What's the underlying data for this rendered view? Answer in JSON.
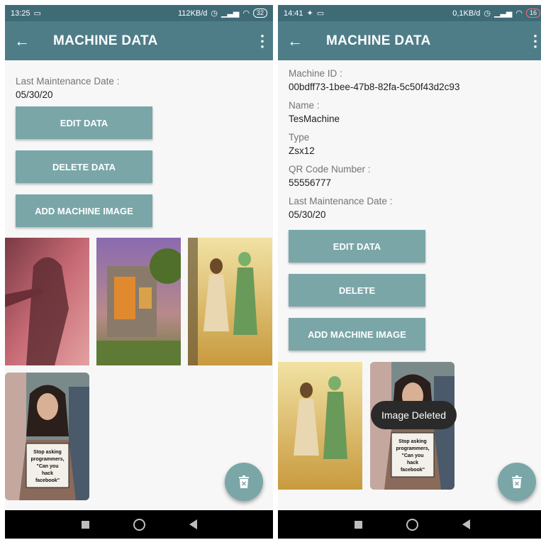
{
  "left": {
    "status": {
      "time": "13:25",
      "speed": "112KB/d",
      "battery": "32"
    },
    "appbar": {
      "title": "MACHINE DATA"
    },
    "fields": [
      {
        "label": "Last Maintenance Date :",
        "value": "05/30/20"
      }
    ],
    "buttons": {
      "edit": "EDIT DATA",
      "delete": "DELETE DATA",
      "add_image": "ADD MACHINE IMAGE"
    },
    "images": [
      "woman-silhouette-photo",
      "stone-house-photo",
      "anime-couple-photo",
      "protest-sign-photo"
    ],
    "sign_text": [
      "Stop asking",
      "programmers,",
      "\"Can you",
      "hack",
      "facebook\""
    ]
  },
  "right": {
    "status": {
      "time": "14:41",
      "speed": "0,1KB/d",
      "battery": "16"
    },
    "appbar": {
      "title": "MACHINE DATA"
    },
    "fields": [
      {
        "label": "Machine ID :",
        "value": "00bdff73-1bee-47b8-82fa-5c50f43d2c93"
      },
      {
        "label": "Name :",
        "value": "TesMachine"
      },
      {
        "label": "Type",
        "value": "Zsx12"
      },
      {
        "label": "QR Code Number :",
        "value": "55556777"
      },
      {
        "label": "Last Maintenance Date :",
        "value": "05/30/20"
      }
    ],
    "buttons": {
      "edit": "EDIT DATA",
      "delete": "DELETE",
      "add_image": "ADD MACHINE IMAGE"
    },
    "toast": "Image Deleted",
    "sign_text": [
      "Stop asking",
      "programmers,",
      "\"Can you",
      "hack",
      "facebook\""
    ]
  },
  "colors": {
    "appbar": "#4e7d88",
    "status_bar": "#3f6b77",
    "button": "#7aa6a8"
  }
}
